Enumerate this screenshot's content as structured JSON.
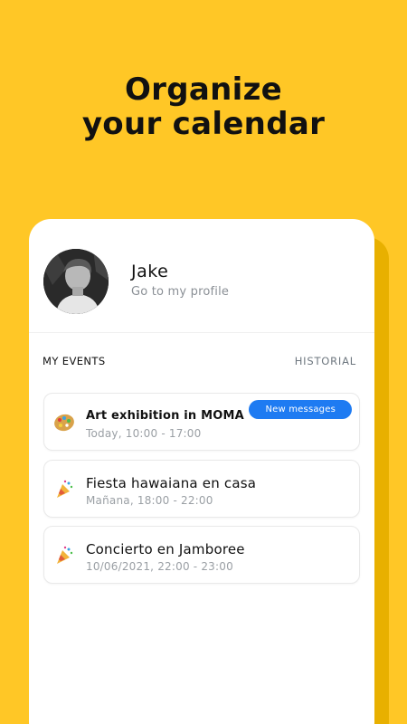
{
  "headline": {
    "line1": "Organize",
    "line2": "your calendar"
  },
  "profile": {
    "name": "Jake",
    "link": "Go to my profile"
  },
  "section": {
    "my_events": "MY EVENTS",
    "historial": "HISTORIAL"
  },
  "events": [
    {
      "title": "Art exhibition in MOMA",
      "time": "Today, 10:00 - 17:00",
      "badge": "New messages",
      "icon": "palette-icon"
    },
    {
      "title": "Fiesta hawaiana en casa",
      "time": "Mañana, 18:00 - 22:00",
      "icon": "party-icon"
    },
    {
      "title": "Concierto en Jamboree",
      "time": "10/06/2021, 22:00 - 23:00",
      "icon": "party-icon"
    }
  ],
  "colors": {
    "background": "#FFC726",
    "badge": "#1E7BF2",
    "card": "#FFFFFF"
  }
}
